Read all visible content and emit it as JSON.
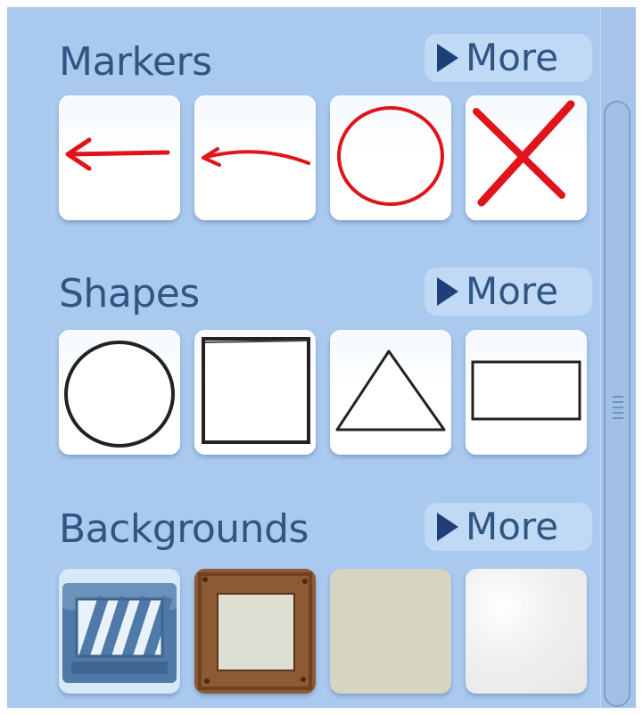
{
  "sections": {
    "markers": {
      "title": "Markers",
      "more_label": "More"
    },
    "shapes": {
      "title": "Shapes",
      "more_label": "More"
    },
    "backgrounds": {
      "title": "Backgrounds",
      "more_label": "More"
    }
  },
  "marker_items": [
    "straight-arrow",
    "curved-arrow",
    "circle",
    "x-mark"
  ],
  "shape_items": [
    "circle",
    "square",
    "triangle",
    "rectangle"
  ],
  "background_items": [
    "striped-frame",
    "wood-frame",
    "beige-plain",
    "white-texture"
  ],
  "colors": {
    "panel": "#a9c9ef",
    "title_text": "#2f5582",
    "marker_red": "#e0141a",
    "shape_stroke": "#222222"
  }
}
